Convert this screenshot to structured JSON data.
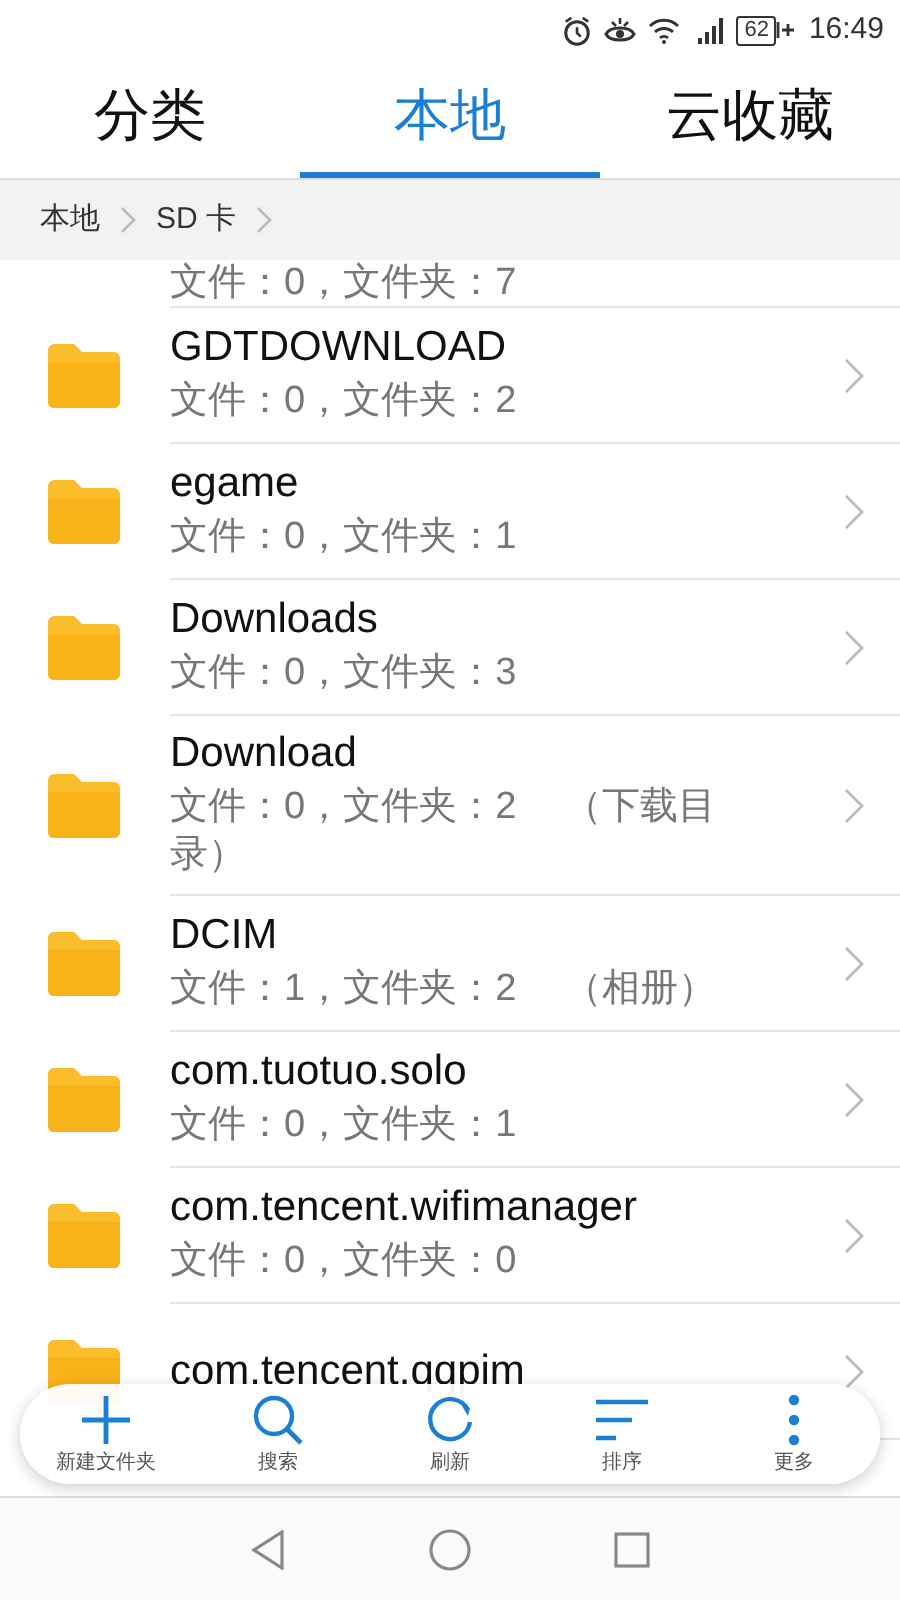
{
  "status_bar": {
    "battery": "62",
    "time": "16:49"
  },
  "tabs": [
    {
      "label": "分类",
      "selected": false
    },
    {
      "label": "本地",
      "selected": true
    },
    {
      "label": "云收藏",
      "selected": false
    }
  ],
  "breadcrumb": [
    "本地",
    "SD 卡"
  ],
  "folders": [
    {
      "subtitle": "文件：0，文件夹：7"
    },
    {
      "name": "GDTDOWNLOAD",
      "subtitle": "文件：0，文件夹：2"
    },
    {
      "name": "egame",
      "subtitle": "文件：0，文件夹：1"
    },
    {
      "name": "Downloads",
      "subtitle": "文件：0，文件夹：3"
    },
    {
      "name": "Download",
      "subtitle": "文件：0，文件夹：2",
      "note": "（下载目录）"
    },
    {
      "name": "DCIM",
      "subtitle": "文件：1，文件夹：2",
      "note": "（相册）"
    },
    {
      "name": "com.tuotuo.solo",
      "subtitle": "文件：0，文件夹：1"
    },
    {
      "name": "com.tencent.wifimanager",
      "subtitle": "文件：0，文件夹：0"
    },
    {
      "name": "com.tencent.qqpim"
    }
  ],
  "toolbar": [
    {
      "kind": "new",
      "label": "新建文件夹"
    },
    {
      "kind": "search",
      "label": "搜索"
    },
    {
      "kind": "refresh",
      "label": "刷新"
    },
    {
      "kind": "sort",
      "label": "排序"
    },
    {
      "kind": "more",
      "label": "更多"
    }
  ]
}
